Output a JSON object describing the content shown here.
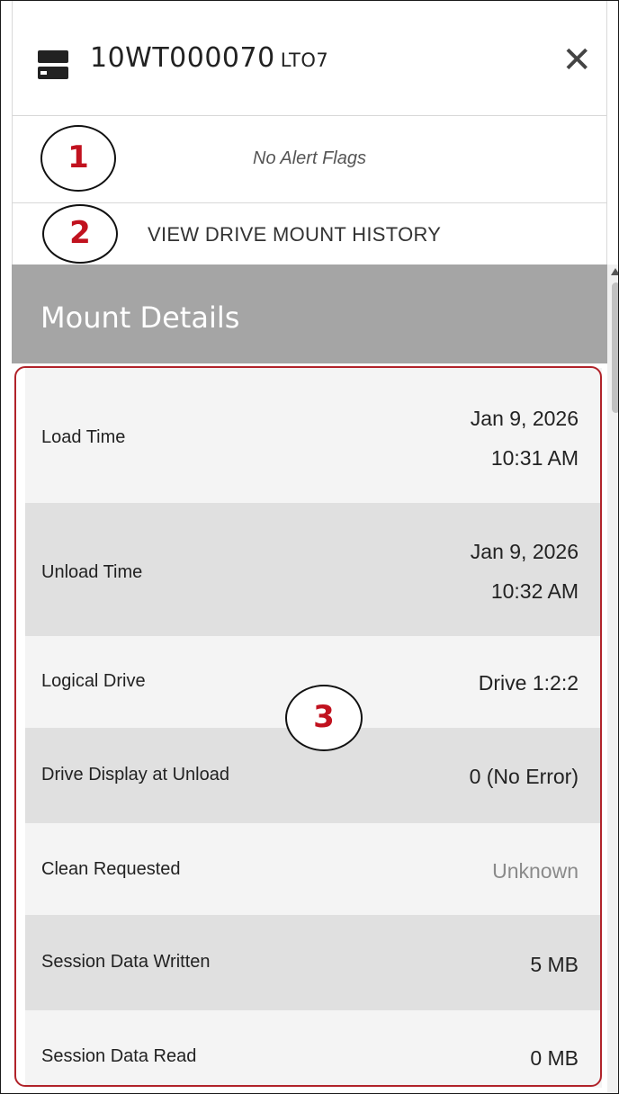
{
  "header": {
    "title": "10WT000070",
    "subtitle": "LTO7",
    "close_glyph": "✕",
    "icon": "drive-icon"
  },
  "alerts": {
    "text": "No Alert Flags"
  },
  "history": {
    "link_label": "VIEW DRIVE MOUNT HISTORY"
  },
  "section": {
    "title": "Mount Details"
  },
  "details": [
    {
      "label": "Load Time",
      "value_line1": "Jan 9, 2026",
      "value_line2": "10:31 AM"
    },
    {
      "label": "Unload Time",
      "value_line1": "Jan 9, 2026",
      "value_line2": "10:32 AM"
    },
    {
      "label": "Logical Drive",
      "value": "Drive 1:2:2"
    },
    {
      "label": "Drive Display at Unload",
      "value": "0 (No Error)"
    },
    {
      "label": "Clean Requested",
      "value": "Unknown"
    },
    {
      "label": "Session Data Written",
      "value": "5 MB"
    },
    {
      "label": "Session Data Read",
      "value": "0 MB"
    }
  ],
  "annotations": [
    "1",
    "2",
    "3"
  ],
  "colors": {
    "section_bg": "#a5a5a5",
    "highlight_border": "#b1232a",
    "annotation_number": "#c1121f",
    "row_light": "#f4f4f4",
    "row_dark": "#e0e0e0"
  }
}
